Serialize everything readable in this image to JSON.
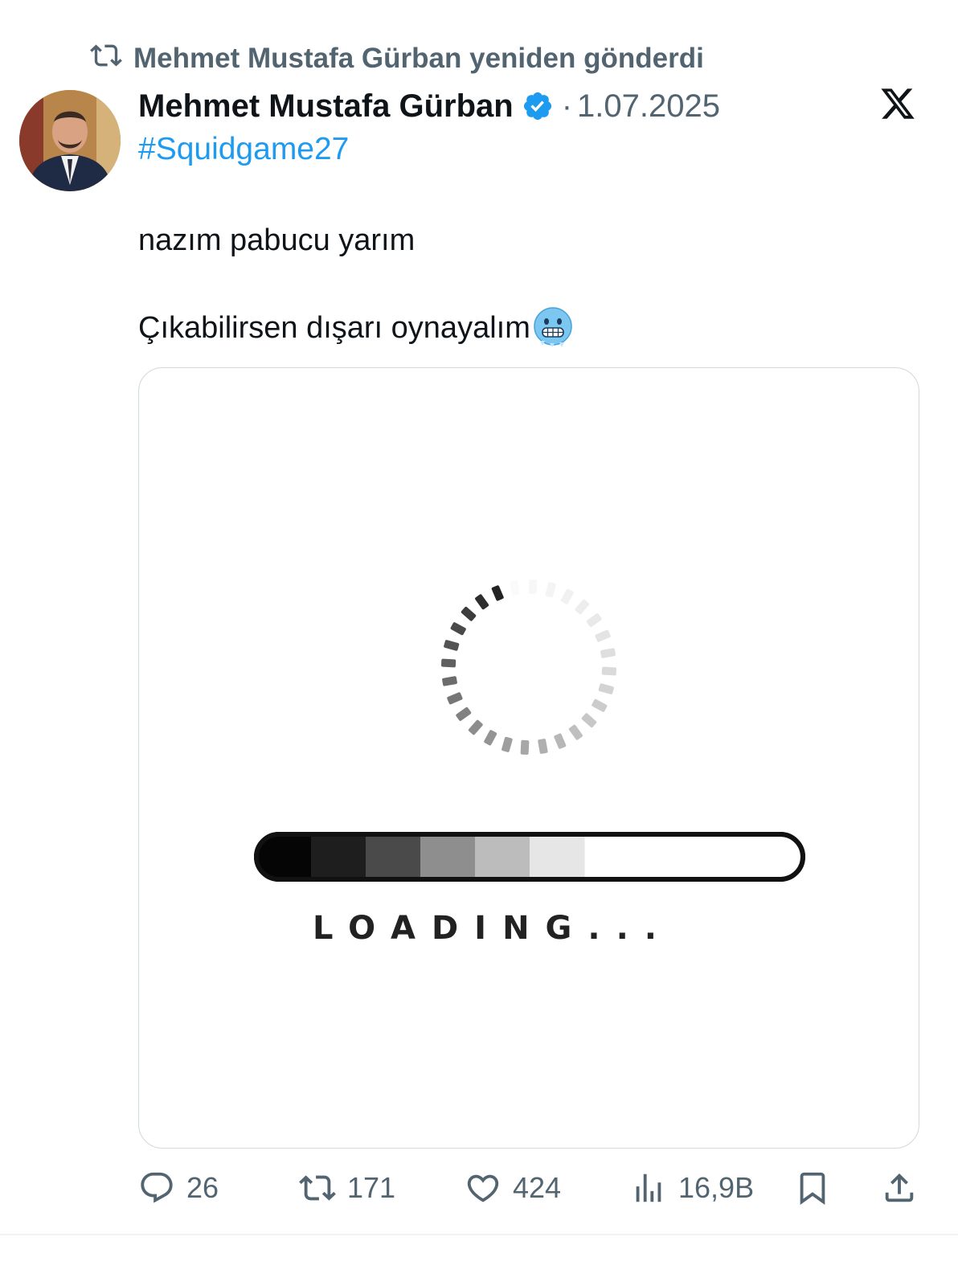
{
  "repost": {
    "label": "Mehmet Mustafa Gürban yeniden gönderdi",
    "icon": "repost-icon"
  },
  "tweet": {
    "author_name": "Mehmet Mustafa Gürban",
    "verified": true,
    "separator": "·",
    "date": "1.07.2025",
    "hashtag": "#Squidgame27",
    "text_line1": "nazım pabucu yarım",
    "text_line2": "Çıkabilirsen dışarı oynayalım",
    "emoji": "cold-face-emoji"
  },
  "media": {
    "loading_text": "LOADING...",
    "progress": 0.6
  },
  "actions": {
    "replies": "26",
    "reposts": "171",
    "likes": "424",
    "views": "16,9B"
  },
  "colors": {
    "accent": "#1d9bf0",
    "secondary_text": "#536471",
    "primary_text": "#0f1419"
  }
}
